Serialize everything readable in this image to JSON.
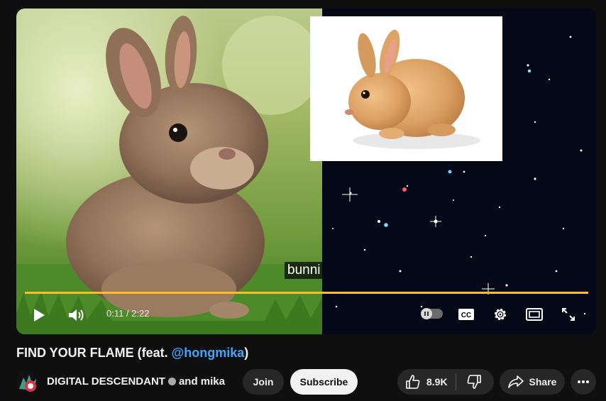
{
  "player": {
    "caption": "bunni",
    "time": "0:11 / 2:22",
    "progress_fraction": 0.08,
    "progress_color": "#fbbf24"
  },
  "video": {
    "title_prefix": "FIND YOUR FLAME (feat. ",
    "title_mention": "@hongmika",
    "title_suffix": ")"
  },
  "channel": {
    "name": "DIGITAL DESCENDANT",
    "coauthor": "and mika",
    "join_label": "Join",
    "subscribe_label": "Subscribe"
  },
  "actions": {
    "like_count": "8.9K",
    "share_label": "Share"
  },
  "icons": {
    "play": "play-icon",
    "volume": "volume-icon",
    "autoplay": "autoplay-toggle",
    "cc": "cc-icon",
    "settings": "gear-icon",
    "theater": "theater-icon",
    "fullscreen": "fullscreen-icon",
    "like": "thumbs-up-icon",
    "dislike": "thumbs-down-icon",
    "share": "share-icon",
    "more": "more-icon"
  }
}
